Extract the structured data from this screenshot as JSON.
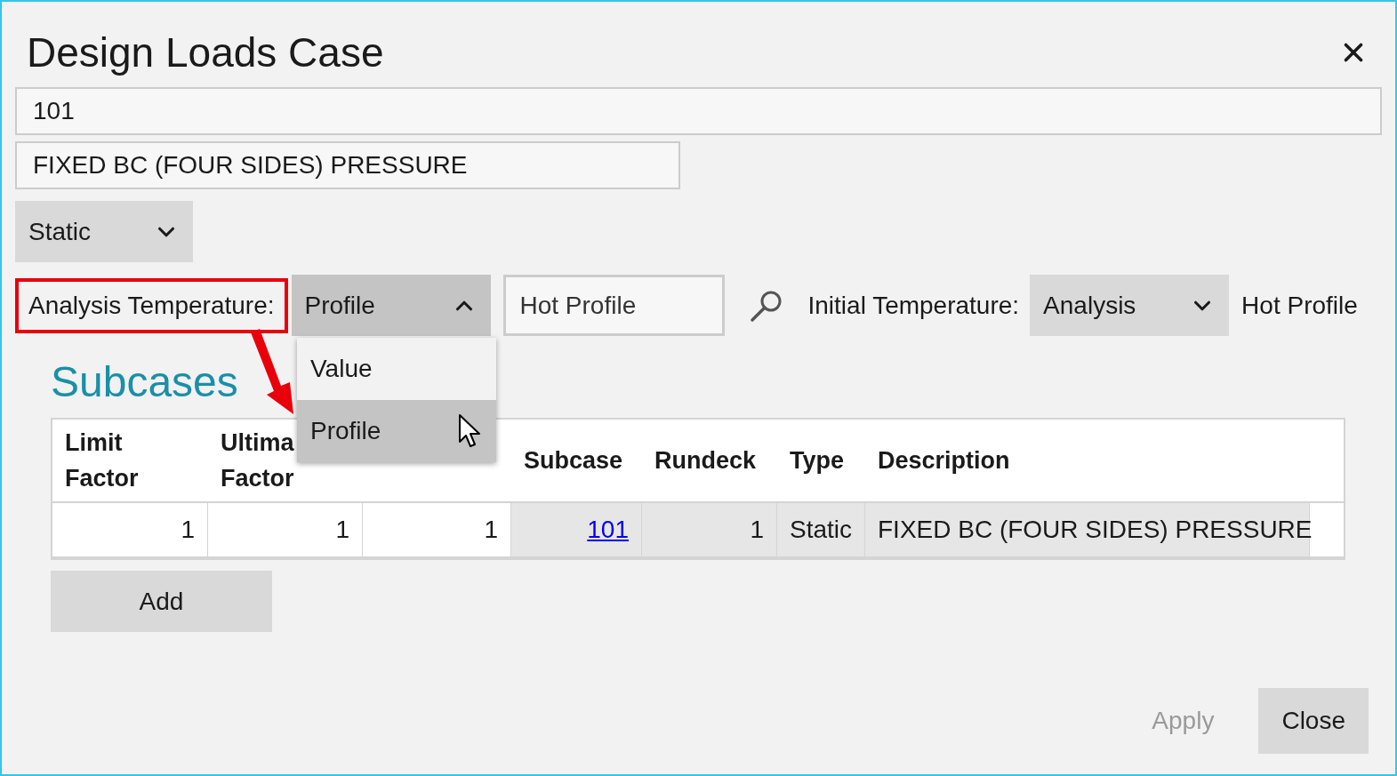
{
  "dialog": {
    "title": "Design Loads Case"
  },
  "id_field": {
    "value": "101"
  },
  "name_field": {
    "value": "FIXED BC (FOUR SIDES) PRESSURE"
  },
  "type_select": {
    "value": "Static",
    "expanded": false
  },
  "analysis_temperature": {
    "label": "Analysis Temperature:",
    "highlighted": true,
    "select": {
      "value": "Profile",
      "expanded": true,
      "options": [
        {
          "label": "Value",
          "selected": false
        },
        {
          "label": "Profile",
          "selected": true
        }
      ]
    },
    "profile_field": {
      "value": "Hot Profile"
    }
  },
  "initial_temperature": {
    "label": "Initial Temperature:",
    "select": {
      "value": "Analysis",
      "expanded": false
    },
    "profile": "Hot Profile"
  },
  "subcases": {
    "heading": "Subcases",
    "columns": [
      {
        "lines": [
          "Limit",
          "Factor"
        ]
      },
      {
        "lines": [
          "Ultima",
          "Factor"
        ]
      },
      {},
      {
        "lines": [
          "Subcase"
        ]
      },
      {
        "lines": [
          "Rundeck"
        ]
      },
      {
        "lines": [
          "Type"
        ]
      },
      {
        "lines": [
          "Description"
        ]
      }
    ],
    "rows": [
      {
        "cells": [
          {
            "text": "1",
            "kind": "input"
          },
          {
            "text": "1",
            "kind": "input"
          },
          {
            "text": "1",
            "kind": "input"
          },
          {
            "text": "101",
            "kind": "link"
          },
          {
            "text": "1",
            "kind": "number"
          },
          {
            "text": "Static",
            "kind": "text"
          },
          {
            "text": "FIXED BC (FOUR SIDES) PRESSURE",
            "kind": "text"
          }
        ]
      }
    ]
  },
  "add_button": {
    "label": "Add"
  },
  "footer_buttons": [
    {
      "label": "Apply",
      "disabled": true
    },
    {
      "label": "Close",
      "disabled": false
    }
  ]
}
